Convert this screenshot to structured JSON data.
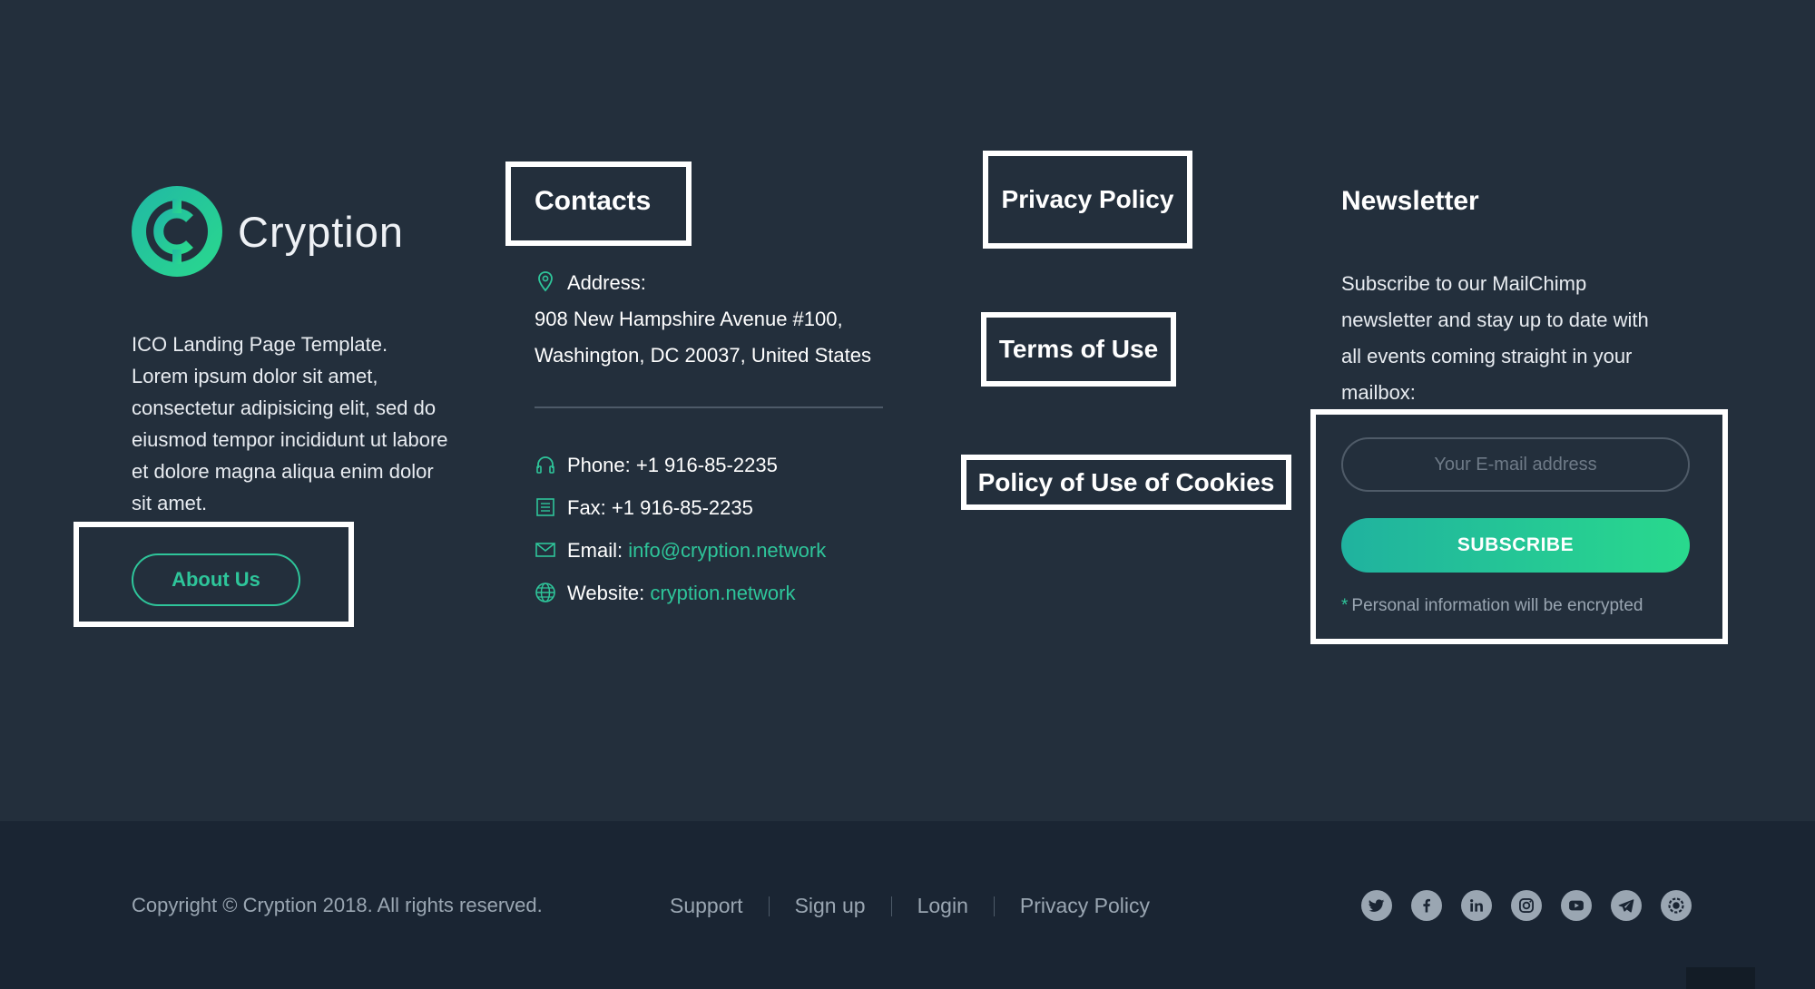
{
  "brand": {
    "name": "Cryption",
    "description_lines": [
      "ICO Landing Page Template.",
      "Lorem ipsum dolor sit amet,",
      "consectetur adipisicing elit, sed do",
      "eiusmod tempor incididunt ut labore",
      "et dolore magna aliqua enim dolor",
      "sit amet."
    ],
    "about_button": "About Us"
  },
  "contacts": {
    "title": "Contacts",
    "address_label": "Address:",
    "address_line1": "908 New Hampshire Avenue #100,",
    "address_line2": "Washington, DC 20037, United States",
    "phone": "Phone: +1 916-85-2235",
    "fax": "Fax: +1 916-85-2235",
    "email_label": "Email:",
    "email_value": "info@cryption.network",
    "website_label": "Website:",
    "website_value": "cryption.network"
  },
  "policies": {
    "privacy": "Privacy Policy",
    "terms": "Terms of Use",
    "cookies": "Policy of Use of Cookies"
  },
  "newsletter": {
    "title": "Newsletter",
    "description_lines": [
      "Subscribe to our MailChimp",
      "newsletter and stay up to date with",
      "all events coming straight in your",
      "mailbox:"
    ],
    "email_placeholder": "Your E-mail address",
    "subscribe_button": "SUBSCRIBE",
    "note_star": "*",
    "note": "Personal information will be encrypted"
  },
  "bottom": {
    "copyright": "Copyright © Cryption 2018. All rights reserved.",
    "nav": [
      "Support",
      "Sign up",
      "Login",
      "Privacy Policy"
    ],
    "social_icons": [
      "twitter-icon",
      "facebook-icon",
      "linkedin-icon",
      "instagram-icon",
      "youtube-icon",
      "telegram-icon",
      "bitcoin-icon"
    ]
  },
  "colors": {
    "background": "#232f3c",
    "bottom_background": "#1a2533",
    "accent": "#2ec59a",
    "muted_text": "#9aa6b2"
  }
}
